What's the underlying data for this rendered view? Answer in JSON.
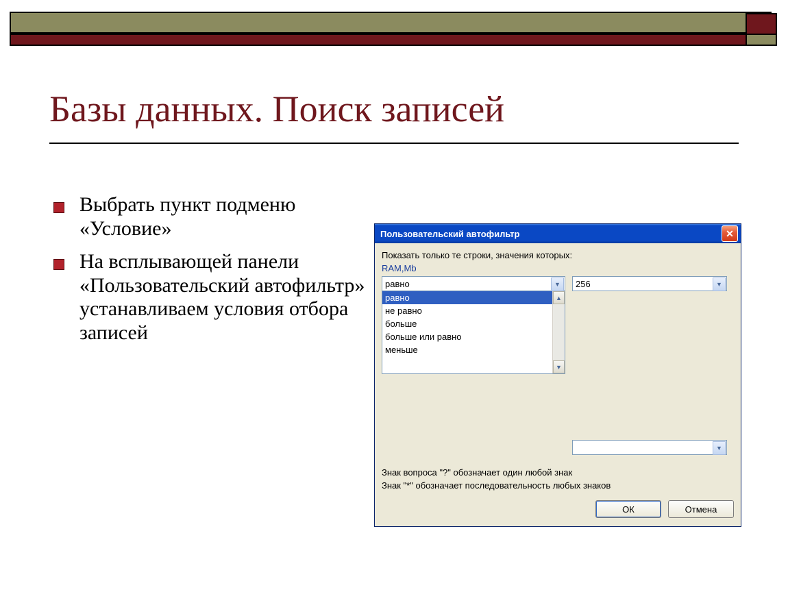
{
  "title": "Базы данных. Поиск записей",
  "bullets": [
    "Выбрать пункт подменю «Условие»",
    "На всплывающей панели «Пользовательский автофильтр» устанавливаем условия отбора записей"
  ],
  "dialog": {
    "title": "Пользовательский автофильтр",
    "instruction": "Показать только те строки, значения которых:",
    "field_label": "RAM,Mb",
    "condition1_value": "равно",
    "value1": "256",
    "condition2_value": "",
    "value2": "",
    "options": [
      "равно",
      "не равно",
      "больше",
      "больше или равно",
      "меньше"
    ],
    "help1": "Знак вопроса \"?\" обозначает один любой знак",
    "help2": "Знак \"*\" обозначает последовательность любых знаков",
    "ok": "ОК",
    "cancel": "Отмена",
    "close_symbol": "✕",
    "arrow_down": "▼",
    "arrow_up": "▲"
  }
}
